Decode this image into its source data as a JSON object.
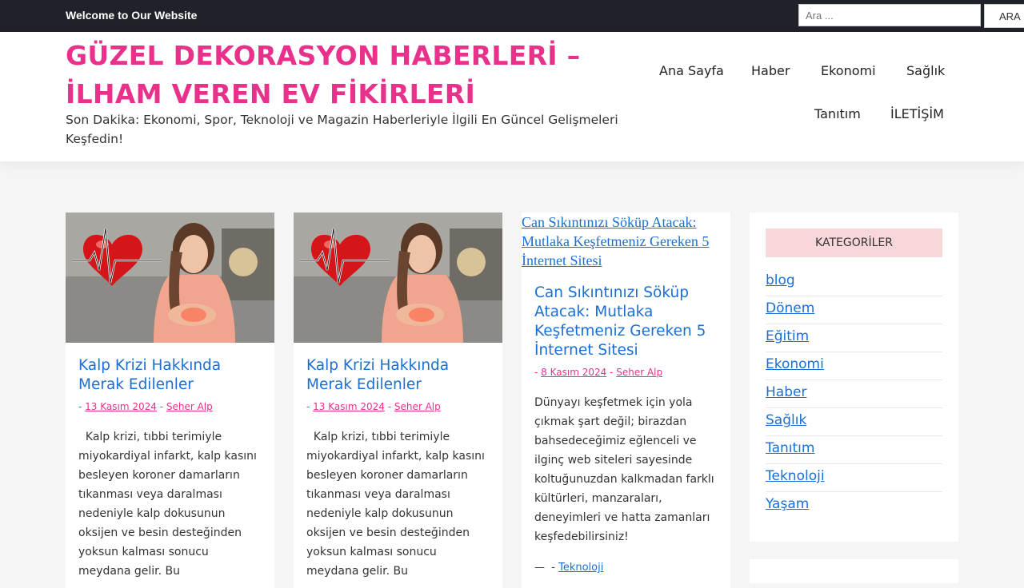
{
  "topbar": {
    "welcome": "Welcome to Our Website",
    "search_placeholder": "Ara ...",
    "search_button": "ARA"
  },
  "header": {
    "title": "GÜZEL DEKORASYON HABERLERİ – İLHAM VEREN EV FİKİRLERİ",
    "description": "Son Dakika: Ekonomi, Spor, Teknoloji ve Magazin Haberleriyle İlgili En Güncel Gelişmeleri Keşfedin!"
  },
  "nav": {
    "items": [
      "Ana Sayfa",
      "Haber",
      "Ekonomi",
      "Sağlık",
      "Tanıtım",
      "İLETİŞİM"
    ]
  },
  "posts": [
    {
      "title": "Kalp Krizi Hakkında Merak Edilenler",
      "date": "13 Kasım 2024",
      "author": "Seher Alp",
      "excerpt": "  Kalp krizi, tıbbi terimiyle miyokardiyal infarkt, kalp kasını besleyen koroner damarların tıkanması veya daralması nedeniyle kalp dokusunun oksijen ve besin desteğinden yoksun kalması sonucu meydana gelir. Bu"
    },
    {
      "title": "Kalp Krizi Hakkında Merak Edilenler",
      "date": "13 Kasım 2024",
      "author": "Seher Alp",
      "excerpt": "  Kalp krizi, tıbbi terimiyle miyokardiyal infarkt, kalp kasını besleyen koroner damarların tıkanması veya daralması nedeniyle kalp dokusunun oksijen ve besin desteğinden yoksun kalması sonucu meydana gelir. Bu"
    },
    {
      "image_alt": "Can Sıkıntınızı Söküp Atacak: Mutlaka Keşfetmeniz Gereken 5 İnternet Sitesi",
      "title": "Can Sıkıntınızı Söküp Atacak: Mutlaka Keşfetmeniz Gereken 5 İnternet Sitesi",
      "date": "8 Kasım 2024",
      "author": "Seher Alp",
      "excerpt": "Dünyayı keşfetmek için yola çıkmak şart değil; birazdan bahsedeceğimiz eğlenceli ve ilginç web siteleri sayesinde koltuğunuzdan kalkmadan farklı kültürleri, manzaraları, deneyimleri ve hatta zamanları keşfedebilirsiniz!",
      "category": "Teknoloji"
    }
  ],
  "sidebar": {
    "title": "KATEGORİLER",
    "categories": [
      "blog",
      "Dönem",
      "Eğitim",
      "Ekonomi",
      "Haber",
      "Sağlık",
      "Tanıtım",
      "Teknoloji",
      "Yaşam"
    ]
  },
  "colors": {
    "brand": "#e8318a",
    "link": "#1a6fd6",
    "topbar": "#1f2228",
    "widget_title_bg": "#f8d7da"
  }
}
